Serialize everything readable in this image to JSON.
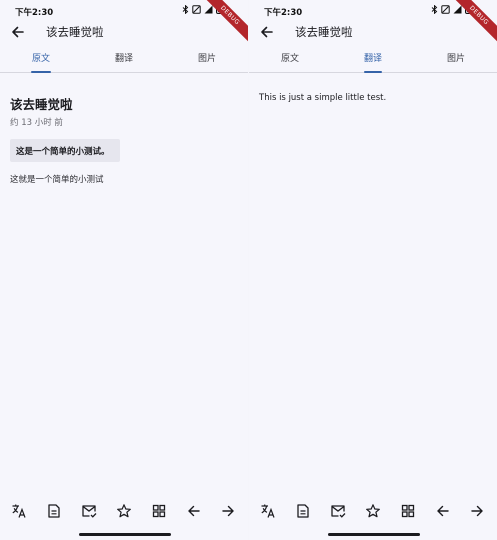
{
  "status": {
    "time": "下午2:30",
    "debug_label": "DEBUG"
  },
  "appbar": {
    "title": "该去睡觉啦"
  },
  "tabs": [
    {
      "label": "原文"
    },
    {
      "label": "翻译"
    },
    {
      "label": "图片"
    }
  ],
  "left": {
    "active_tab": 0,
    "post": {
      "title": "该去睡觉啦",
      "time": "约 13 小时 前",
      "quote": "这是一个简单的小测试。",
      "body": "这就是一个简单的小测试"
    }
  },
  "right": {
    "active_tab": 1,
    "translation": "This is just a simple little test."
  },
  "bottom_bar": {
    "icons": [
      "translate-icon",
      "document-icon",
      "mark-read-icon",
      "star-icon",
      "grid-icon",
      "arrow-left-icon",
      "arrow-right-icon"
    ]
  },
  "colors": {
    "accent": "#3563a8",
    "background": "#f6f6fc",
    "quote_bg": "#e6e6ee",
    "debug": "#b3262b"
  }
}
